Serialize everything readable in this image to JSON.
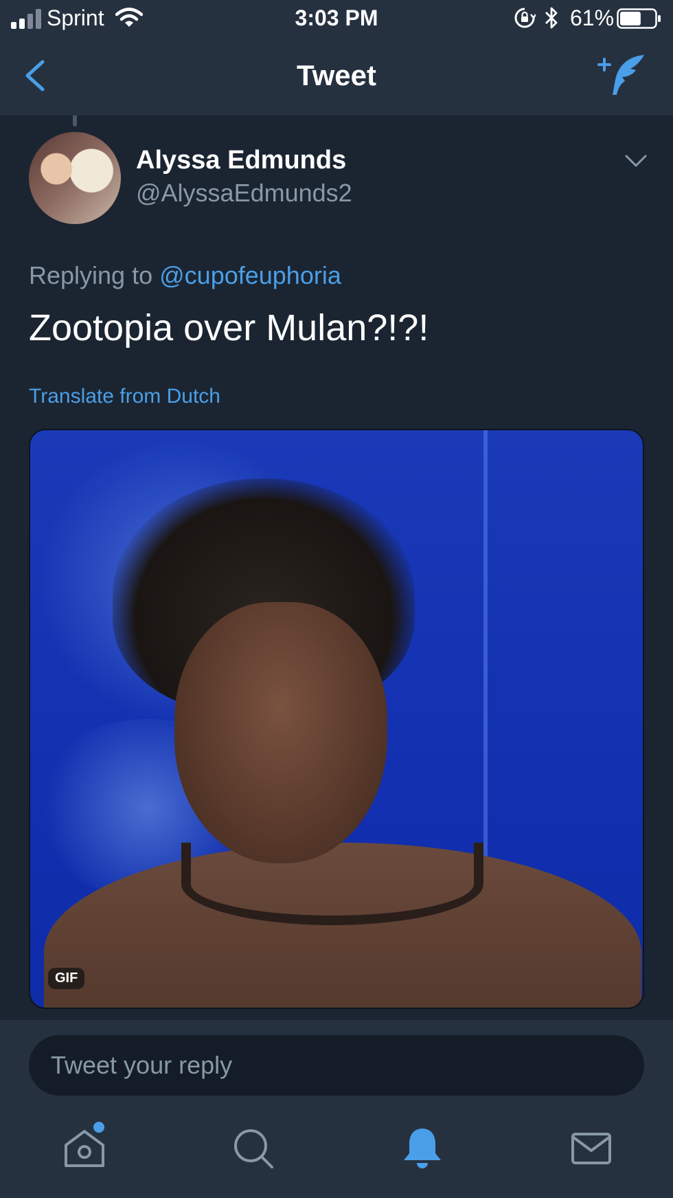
{
  "status_bar": {
    "carrier": "Sprint",
    "time": "3:03 PM",
    "battery_percent": "61%",
    "battery_level": 0.61,
    "icons": [
      "signal-icon",
      "wifi-icon",
      "rotation-lock-icon",
      "bluetooth-icon",
      "battery-icon"
    ]
  },
  "nav": {
    "title": "Tweet",
    "back_icon": "chevron-left-icon",
    "compose_icon": "compose-tweet-icon"
  },
  "tweet": {
    "display_name": "Alyssa Edmunds",
    "handle": "@AlyssaEdmunds2",
    "replying_prefix": "Replying to",
    "replying_to": "@cupofeuphoria",
    "text": "Zootopia over Mulan?!?!",
    "translate": "Translate from Dutch",
    "media_badge": "GIF"
  },
  "reply": {
    "placeholder": "Tweet your reply"
  },
  "tabs": [
    {
      "icon": "home-icon",
      "active": false,
      "has_notification_dot": true
    },
    {
      "icon": "search-icon",
      "active": false
    },
    {
      "icon": "bell-icon",
      "active": true
    },
    {
      "icon": "mail-icon",
      "active": false
    }
  ],
  "colors": {
    "background": "#1b2531",
    "bars": "#263140",
    "accent": "#4a9fe8",
    "secondary_text": "#8899a6"
  }
}
